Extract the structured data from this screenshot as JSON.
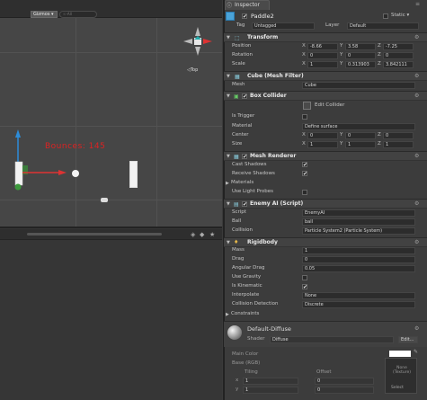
{
  "scene": {
    "gizmos_label": "Gizmos ▾",
    "search_placeholder": "☉·All",
    "score_text": "Bounces: 145",
    "view_label": "◁Top"
  },
  "inspector": {
    "tab_label": "Inspector",
    "object_name": "Paddle2",
    "static_label": "Static ▾",
    "tag_label": "Tag",
    "tag_value": "Untagged",
    "layer_label": "Layer",
    "layer_value": "Default",
    "transform": {
      "title": "Transform",
      "position_label": "Position",
      "rotation_label": "Rotation",
      "scale_label": "Scale",
      "position": [
        "-8.66",
        "3.58",
        "-7.25"
      ],
      "rotation": [
        "0",
        "0",
        "0"
      ],
      "scale": [
        "1",
        "0.313903",
        "3.842111"
      ]
    },
    "mesh_filter": {
      "title": "Cube (Mesh Filter)",
      "mesh_label": "Mesh",
      "mesh_value": "Cube"
    },
    "box_collider": {
      "title": "Box Collider",
      "edit_label": "Edit Collider",
      "is_trigger_label": "Is Trigger",
      "material_label": "Material",
      "material_value": "Define surface",
      "center_label": "Center",
      "size_label": "Size",
      "center": [
        "0",
        "0",
        "0"
      ],
      "size": [
        "1",
        "1",
        "1"
      ]
    },
    "mesh_renderer": {
      "title": "Mesh Renderer",
      "cast_label": "Cast Shadows",
      "receive_label": "Receive Shadows",
      "materials_label": "Materials",
      "light_probes_label": "Use Light Probes"
    },
    "enemy_ai": {
      "title": "Enemy AI (Script)",
      "script_label": "Script",
      "script_value": "EnemyAI",
      "ball_label": "Ball",
      "ball_value": "ball",
      "collision_label": "Collision",
      "collision_value": "Particle System2 (Particle System)"
    },
    "rigidbody": {
      "title": "Rigidbody",
      "mass_label": "Mass",
      "mass_value": "1",
      "drag_label": "Drag",
      "drag_value": "0",
      "angular_label": "Angular Drag",
      "angular_value": "0.05",
      "gravity_label": "Use Gravity",
      "kinematic_label": "Is Kinematic",
      "interpolate_label": "Interpolate",
      "interpolate_value": "None",
      "collision_label": "Collision Detection",
      "collision_value": "Discrete",
      "constraints_label": "Constraints"
    },
    "material": {
      "title": "Default-Diffuse",
      "shader_label": "Shader",
      "shader_value": "Diffuse",
      "edit_label": "Edit...",
      "main_color_label": "Main Color",
      "base_label": "Base (RGB)",
      "tiling_label": "Tiling",
      "offset_label": "Offset",
      "tiling": [
        "1",
        "1"
      ],
      "offset": [
        "0",
        "0"
      ],
      "none_texture_label": "None (Texture)",
      "select_label": "Select",
      "x_label": "x",
      "y_label": "y"
    }
  }
}
